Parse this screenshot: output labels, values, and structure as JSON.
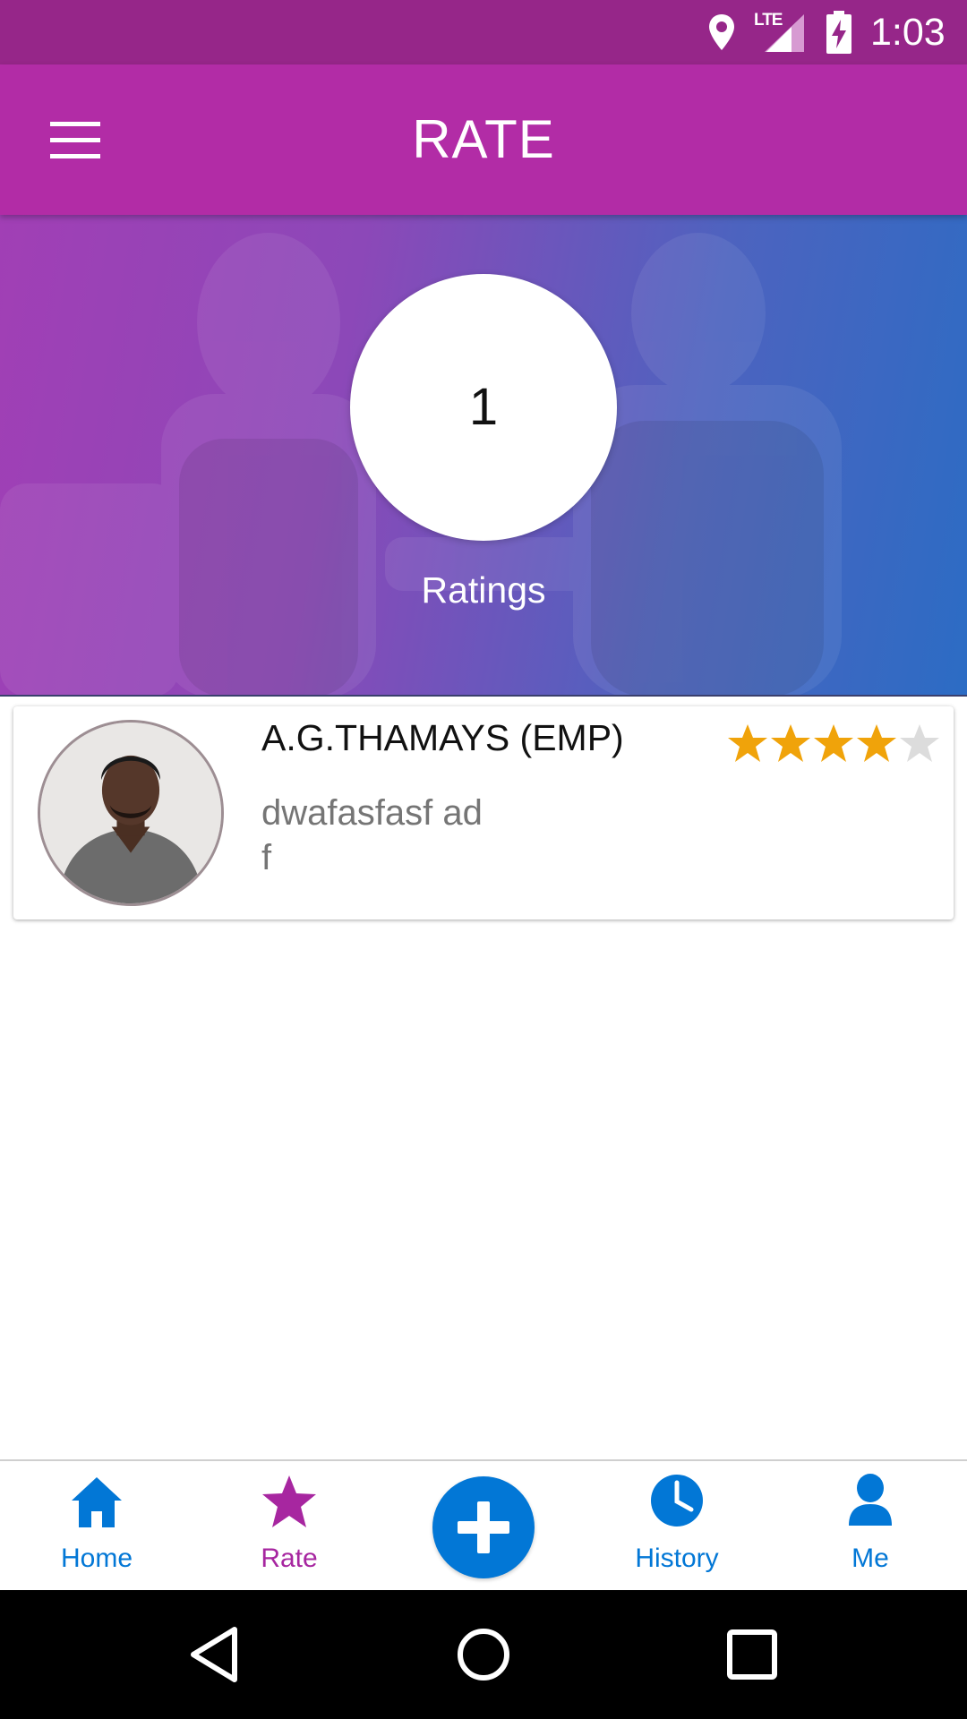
{
  "status_bar": {
    "network": "LTE",
    "time": "1:03",
    "icons": [
      "location-icon",
      "signal-icon",
      "battery-charging-icon"
    ]
  },
  "app_bar": {
    "title": "RATE",
    "menu_icon": "hamburger-menu-icon"
  },
  "summary": {
    "count": "1",
    "label": "Ratings"
  },
  "ratings": [
    {
      "name": "A.G.THAMAYS (EMP)",
      "comment": "dwafasfasf ad\n f",
      "stars": 4,
      "max_stars": 5
    }
  ],
  "bottom_nav": {
    "items": [
      {
        "label": "Home",
        "icon": "home-icon",
        "active": false
      },
      {
        "label": "Rate",
        "icon": "star-icon",
        "active": true
      },
      {
        "label": "History",
        "icon": "clock-icon",
        "active": false
      },
      {
        "label": "Me",
        "icon": "person-icon",
        "active": false
      }
    ],
    "fab_icon": "plus-icon"
  },
  "colors": {
    "status_bar": "#962689",
    "app_bar": "#b22ca6",
    "nav_blue": "#0277d6",
    "nav_active": "#a726a0",
    "star_filled": "#f0a30a",
    "star_empty": "#dcdcdc"
  }
}
